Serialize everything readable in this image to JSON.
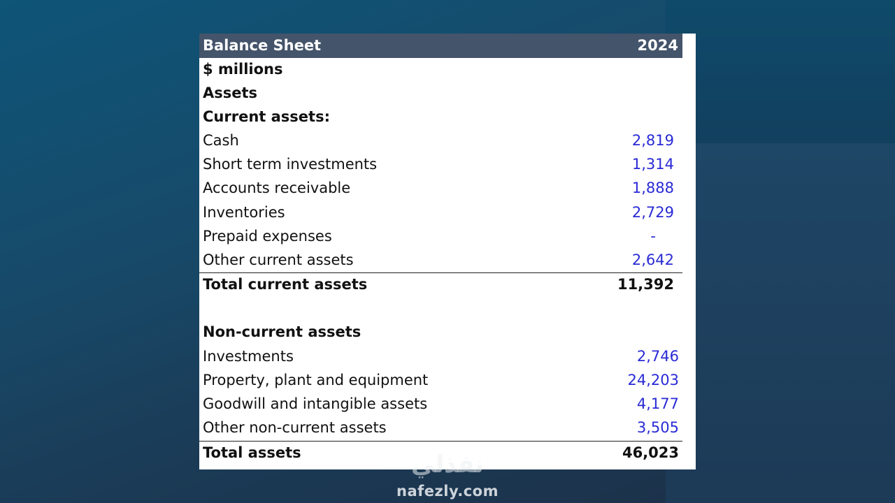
{
  "sheet": {
    "title": "Balance Sheet",
    "year": "2024",
    "units": "$ millions",
    "section_assets": "Assets",
    "current_heading": "Current assets:",
    "current_items": [
      {
        "label": "Cash",
        "value": "2,819"
      },
      {
        "label": "Short term investments",
        "value": "1,314"
      },
      {
        "label": "Accounts receivable",
        "value": "1,888"
      },
      {
        "label": "Inventories",
        "value": "2,729"
      },
      {
        "label": "Prepaid expenses",
        "value": "-"
      },
      {
        "label": "Other current assets",
        "value": "2,642"
      }
    ],
    "total_current": {
      "label": "Total current assets",
      "value": "11,392"
    },
    "noncurrent_heading": "Non-current assets",
    "noncurrent_items": [
      {
        "label": "Investments",
        "value": "2,746"
      },
      {
        "label": "Property, plant and equipment",
        "value": "24,203"
      },
      {
        "label": "Goodwill and intangible assets",
        "value": "4,177"
      },
      {
        "label": "Other non-current assets",
        "value": "3,505"
      }
    ],
    "total_assets": {
      "label": "Total assets",
      "value": "46,023"
    }
  },
  "watermark": {
    "arabic": "نفذلي",
    "latin": "nafezly.com"
  },
  "colors": {
    "header_bg": "#44546a",
    "input_value": "#2a2ad6",
    "background": "#174a6a"
  }
}
